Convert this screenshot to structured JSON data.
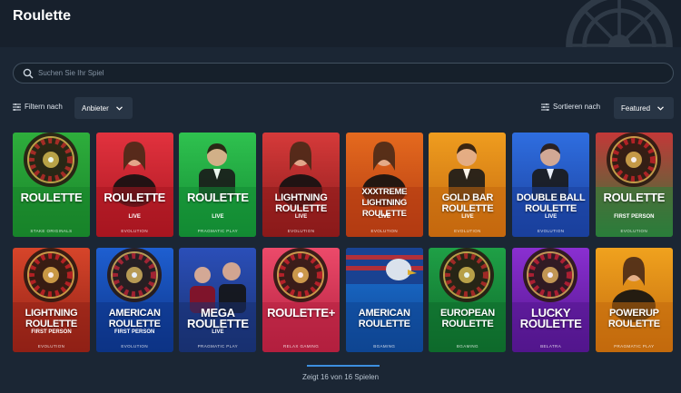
{
  "page": {
    "title": "Roulette"
  },
  "search": {
    "placeholder": "Suchen Sie Ihr Spiel"
  },
  "filters": {
    "filter_label": "Filtern nach",
    "provider_value": "Anbieter",
    "sort_label": "Sortieren nach",
    "sort_value": "Featured"
  },
  "games": [
    {
      "name": "ROULETTE",
      "sub": "",
      "provider": "STAKE ORIGINALS",
      "color": "#2eae3c",
      "color2": "#18832a",
      "icon": "roulette-wheel"
    },
    {
      "name": "ROULETTE",
      "sub": "LIVE",
      "provider": "EVOLUTION",
      "color": "#e2323e",
      "color2": "#a81620",
      "icon": "dealer-woman"
    },
    {
      "name": "ROULETTE",
      "sub": "LIVE",
      "provider": "PRAGMATIC PLAY",
      "color": "#2fc24f",
      "color2": "#138a33",
      "icon": "dealer-man"
    },
    {
      "name": "LIGHTNING ROULETTE",
      "sub": "LIVE",
      "provider": "EVOLUTION",
      "color": "#d63a3a",
      "color2": "#8a1a1a",
      "icon": "dealer-woman"
    },
    {
      "name": "XXXTREME LIGHTNING ROULETTE",
      "sub": "LIVE",
      "provider": "EVOLUTION",
      "color": "#e56a1e",
      "color2": "#b23a12",
      "icon": "dealer-woman"
    },
    {
      "name": "GOLD BAR ROULETTE",
      "sub": "LIVE",
      "provider": "EVOLUTION",
      "color": "#ef9d1f",
      "color2": "#c4680e",
      "icon": "dealer-man"
    },
    {
      "name": "DOUBLE BALL ROULETTE",
      "sub": "LIVE",
      "provider": "EVOLUTION",
      "color": "#2f6ee0",
      "color2": "#1a3f9c",
      "icon": "dealer-man"
    },
    {
      "name": "ROULETTE",
      "sub": "FIRST PERSON",
      "provider": "EVOLUTION",
      "color": "#c33838",
      "color2": "#2a7d3a",
      "icon": "roulette-wheel"
    },
    {
      "name": "LIGHTNING ROULETTE",
      "sub": "FIRST PERSON",
      "provider": "EVOLUTION",
      "color": "#d7452a",
      "color2": "#8f2016",
      "icon": "roulette-wheel"
    },
    {
      "name": "AMERICAN ROULETTE",
      "sub": "FIRST PERSON",
      "provider": "EVOLUTION",
      "color": "#1e5fd1",
      "color2": "#0d3385",
      "icon": "roulette-wheel"
    },
    {
      "name": "MEGA ROULETTE",
      "sub": "LIVE",
      "provider": "PRAGMATIC PLAY",
      "color": "#2b4fb9",
      "color2": "#18306f",
      "icon": "dealer-couple"
    },
    {
      "name": "ROULETTE+",
      "sub": "",
      "provider": "RELAX GAMING",
      "color": "#ec4a6a",
      "color2": "#b21f3e",
      "icon": "roulette-wheel"
    },
    {
      "name": "AMERICAN ROULETTE",
      "sub": "",
      "provider": "BGAMING",
      "color": "#1c73d6",
      "color2": "#0f4592",
      "icon": "eagle"
    },
    {
      "name": "EUROPEAN ROULETTE",
      "sub": "",
      "provider": "BGAMING",
      "color": "#1fa046",
      "color2": "#0e6a2b",
      "icon": "roulette-wheel"
    },
    {
      "name": "LUCKY ROULETTE",
      "sub": "",
      "provider": "BELATRA",
      "color": "#8a2fd1",
      "color2": "#52168c",
      "icon": "roulette-wheel"
    },
    {
      "name": "POWERUP ROULETTE",
      "sub": "",
      "provider": "PRAGMATIC PLAY",
      "color": "#f0a21e",
      "color2": "#c2690d",
      "icon": "dealer-woman"
    }
  ],
  "footer": {
    "count_text": "Zeigt 16 von 16 Spielen"
  }
}
